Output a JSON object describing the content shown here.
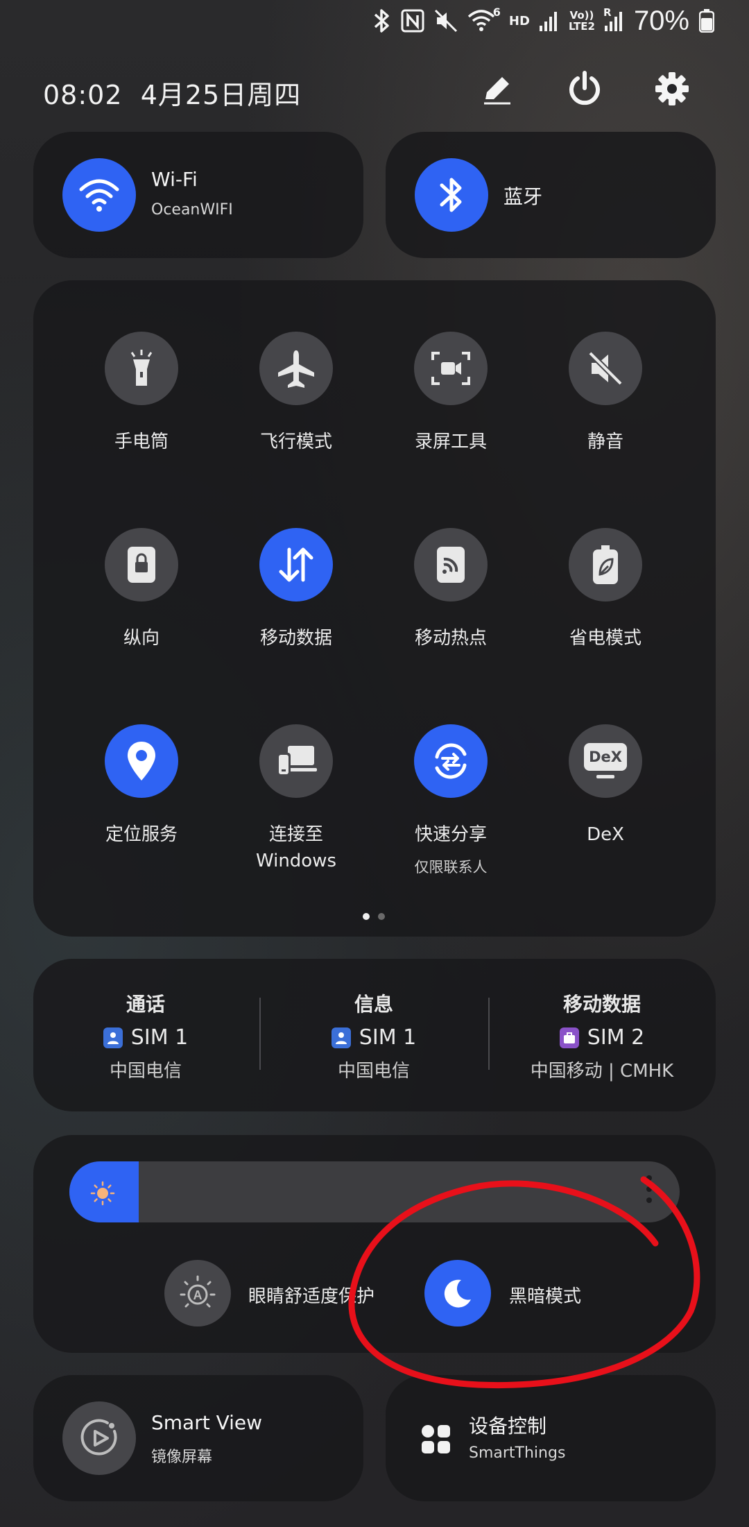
{
  "status_bar": {
    "battery": "70%",
    "network_tags": {
      "hd": "HD",
      "volte_top": "Vo))",
      "volte_bottom": "LTE2",
      "r": "R",
      "wifi_6": "6"
    }
  },
  "header": {
    "time": "08:02",
    "date": "4月25日周四",
    "edit_icon": "pencil-icon",
    "power_icon": "power-icon",
    "settings_icon": "gear-icon"
  },
  "wifi": {
    "title": "Wi-Fi",
    "subtitle": "OceanWIFI",
    "active": true
  },
  "bluetooth": {
    "title": "蓝牙",
    "active": true
  },
  "quick_tiles": [
    {
      "label": "手电筒",
      "icon": "flashlight-icon",
      "active": false
    },
    {
      "label": "飞行模式",
      "icon": "airplane-icon",
      "active": false
    },
    {
      "label": "录屏工具",
      "icon": "screen-record-icon",
      "active": false
    },
    {
      "label": "静音",
      "icon": "mute-icon",
      "active": false
    },
    {
      "label": "纵向",
      "icon": "rotation-lock-icon",
      "active": false
    },
    {
      "label": "移动数据",
      "icon": "mobile-data-icon",
      "active": true
    },
    {
      "label": "移动热点",
      "icon": "hotspot-icon",
      "active": false
    },
    {
      "label": "省电模式",
      "icon": "power-saving-icon",
      "active": false
    },
    {
      "label": "定位服务",
      "icon": "location-icon",
      "active": true
    },
    {
      "label": "连接至",
      "label2": "Windows",
      "icon": "link-to-windows-icon",
      "active": false
    },
    {
      "label": "快速分享",
      "sub": "仅限联系人",
      "icon": "quick-share-icon",
      "active": true
    },
    {
      "label": "DeX",
      "icon": "dex-icon",
      "dex_text": "DeX",
      "active": false
    }
  ],
  "pager": {
    "pages": 2,
    "current": 1
  },
  "sim": [
    {
      "title": "通话",
      "sim": "SIM 1",
      "carrier": "中国电信",
      "color": "#3b6fd8"
    },
    {
      "title": "信息",
      "sim": "SIM 1",
      "carrier": "中国电信",
      "color": "#3b6fd8"
    },
    {
      "title": "移动数据",
      "sim": "SIM 2",
      "carrier": "中国移动 | CMHK",
      "color": "#8a52c8"
    }
  ],
  "brightness": {
    "level": 0.08
  },
  "display_toggles": {
    "eye_comfort": {
      "label": "眼睛舒适度保护",
      "icon": "eye-comfort-icon",
      "active": false,
      "badge": "A"
    },
    "dark_mode": {
      "label": "黑暗模式",
      "icon": "moon-icon",
      "active": true
    }
  },
  "bottom": {
    "smart_view": {
      "title": "Smart View",
      "subtitle": "镜像屏幕"
    },
    "device_control": {
      "title": "设备控制",
      "subtitle": "SmartThings"
    }
  },
  "colors": {
    "accent": "#2f63f3",
    "annotation": "#e8101a"
  }
}
